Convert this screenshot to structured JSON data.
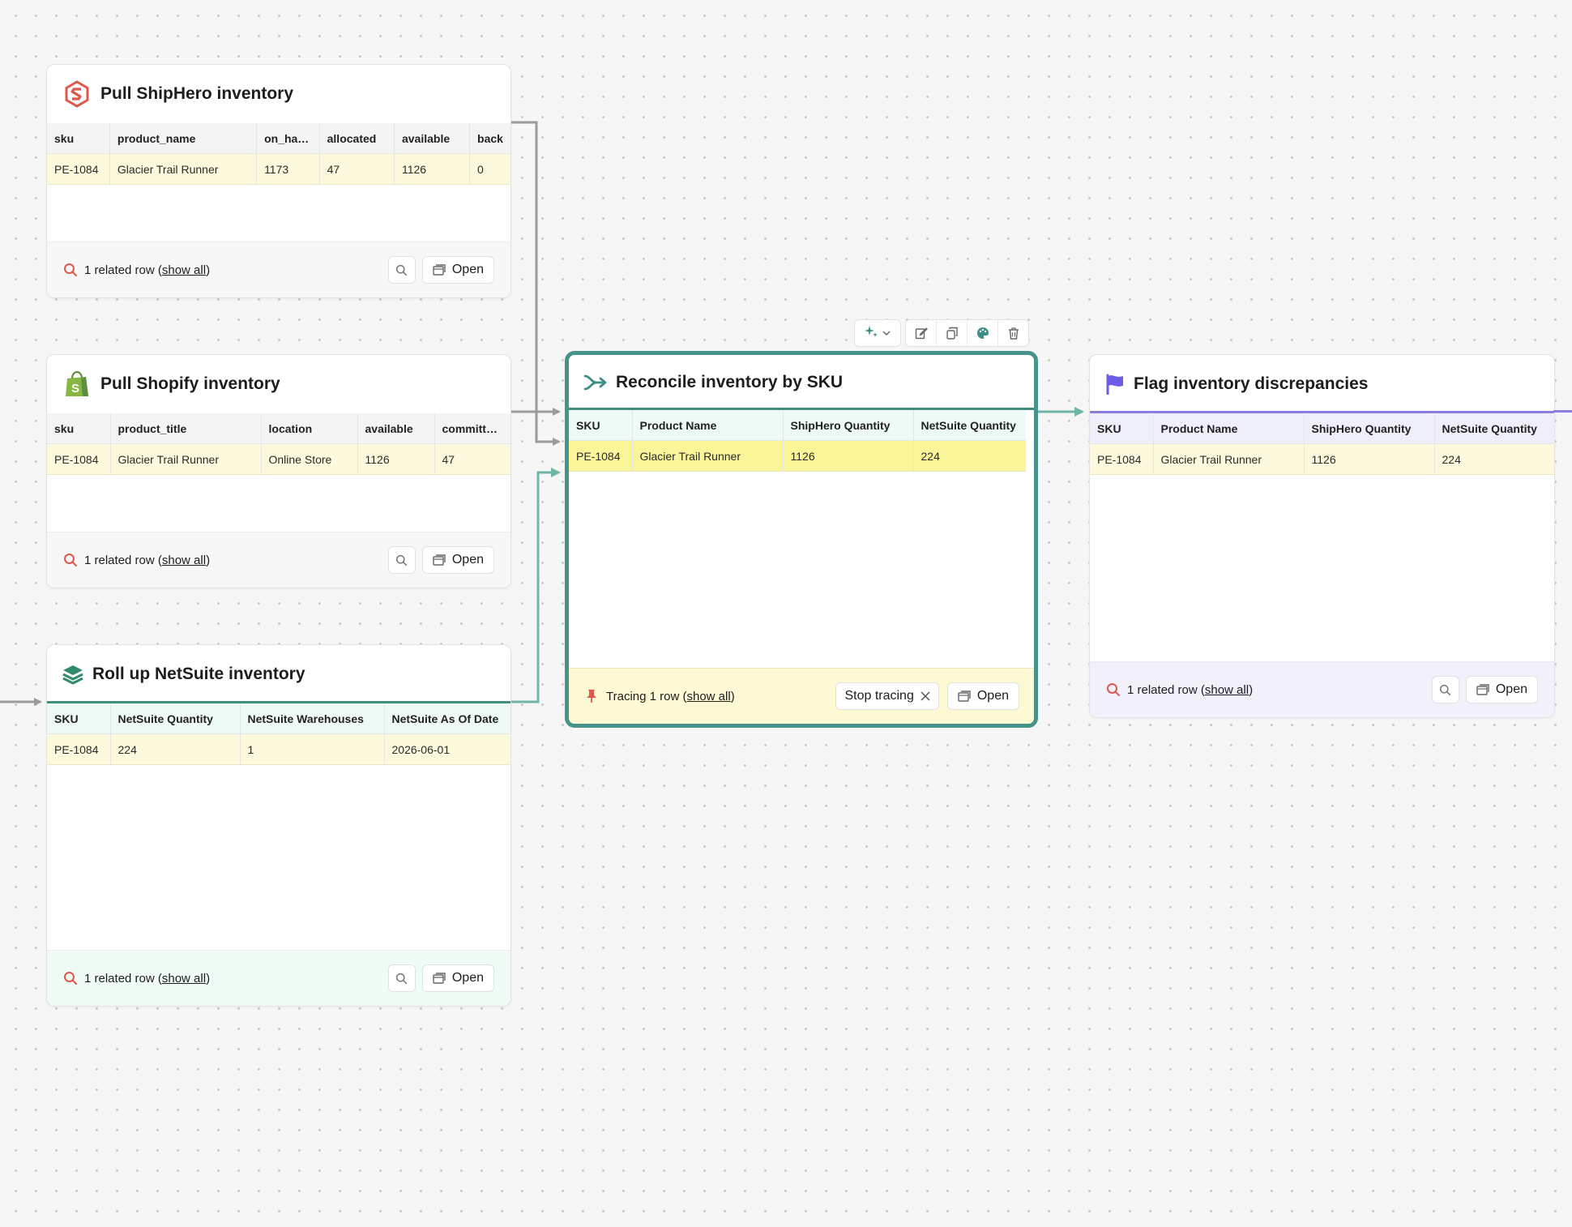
{
  "colors": {
    "accent_teal": "#45938a",
    "edge_gray": "#9b9b9b",
    "edge_teal": "#6fb5a8",
    "edge_purple": "#8a7fe0",
    "row_highlight": "#fdf9dc",
    "row_traced": "#fbf59a",
    "shiphero_red": "#e0584b",
    "shopify_green": "#86b740",
    "flag_purple": "#6c5ce7"
  },
  "nodes": {
    "shiphero": {
      "title": "Pull ShipHero inventory",
      "icon": "shiphero-logo-icon",
      "columns": [
        "sku",
        "product_name",
        "on_ha…",
        "allocated",
        "available",
        "back"
      ],
      "rows": [
        [
          "PE-1084",
          "Glacier Trail Runner",
          "1173",
          "47",
          "1126",
          "0"
        ]
      ],
      "footer": {
        "count_text": "1 related row (",
        "link": "show all",
        "close": ")",
        "open_label": "Open"
      }
    },
    "shopify": {
      "title": "Pull Shopify inventory",
      "icon": "shopify-bag-icon",
      "columns": [
        "sku",
        "product_title",
        "location",
        "available",
        "committ…"
      ],
      "rows": [
        [
          "PE-1084",
          "Glacier Trail Runner",
          "Online Store",
          "1126",
          "47"
        ]
      ],
      "footer": {
        "count_text": "1 related row (",
        "link": "show all",
        "close": ")",
        "open_label": "Open"
      }
    },
    "netsuite": {
      "title": "Roll up NetSuite inventory",
      "icon": "stack-layers-icon",
      "columns": [
        "SKU",
        "NetSuite Quantity",
        "NetSuite Warehouses",
        "NetSuite As Of Date"
      ],
      "rows": [
        [
          "PE-1084",
          "224",
          "1",
          "2026-06-01"
        ]
      ],
      "footer": {
        "count_text": "1 related row (",
        "link": "show all",
        "close": ")",
        "open_label": "Open"
      }
    },
    "reconcile": {
      "title": "Reconcile inventory by SKU",
      "icon": "merge-arrow-icon",
      "columns": [
        "SKU",
        "Product Name",
        "ShipHero Quantity",
        "NetSuite Quantity"
      ],
      "rows": [
        [
          "PE-1084",
          "Glacier Trail Runner",
          "1126",
          "224"
        ]
      ],
      "footer": {
        "count_text": "Tracing 1 row (",
        "link": "show all",
        "close": ")",
        "stop_label": "Stop tracing",
        "open_label": "Open"
      }
    },
    "flag": {
      "title": "Flag inventory discrepancies",
      "icon": "flag-icon",
      "columns": [
        "SKU",
        "Product Name",
        "ShipHero Quantity",
        "NetSuite Quantity"
      ],
      "rows": [
        [
          "PE-1084",
          "Glacier Trail Runner",
          "1126",
          "224"
        ]
      ],
      "footer": {
        "count_text": "1 related row (",
        "link": "show all",
        "close": ")",
        "open_label": "Open"
      }
    }
  },
  "toolbar": {
    "items": [
      "ai-sparkle-icon",
      "chevron-down-icon",
      "edit-icon",
      "duplicate-icon",
      "palette-icon",
      "trash-icon"
    ]
  }
}
